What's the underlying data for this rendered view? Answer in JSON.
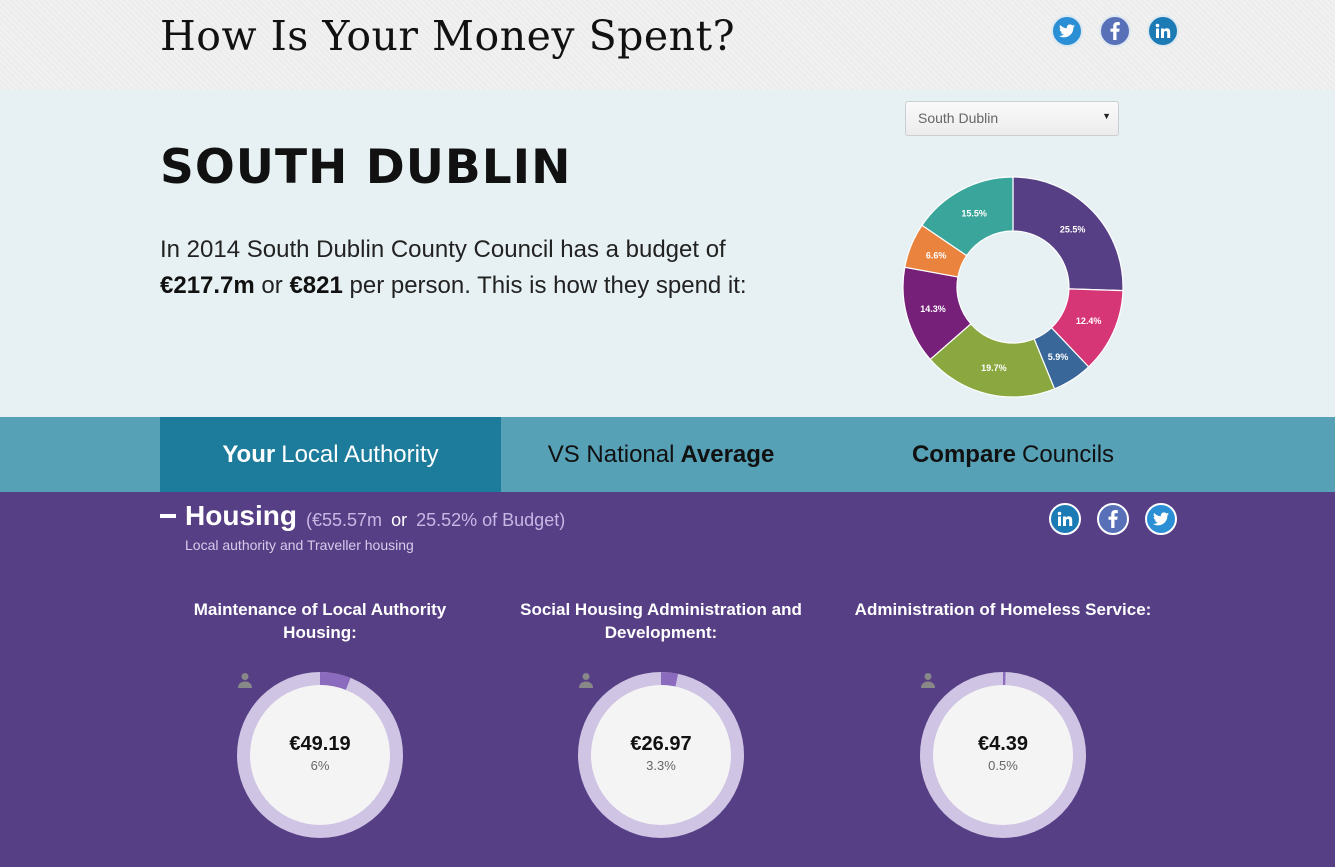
{
  "header": {
    "title": "How Is Your Money Spent?",
    "share_icons": [
      "twitter-icon",
      "facebook-icon",
      "linkedin-icon"
    ]
  },
  "hero": {
    "region_select": {
      "selected": "South Dublin"
    },
    "council_name": "SOUTH DUBLIN",
    "intro_prefix": "In 2014 South Dublin County Council has a budget of",
    "budget_total": "€217.7m",
    "intro_or": "or",
    "budget_per_person": "€821",
    "intro_suffix": "per person. This is how they spend it:"
  },
  "chart_data": {
    "type": "pie",
    "donut": true,
    "categories": [
      "Housing",
      "",
      "",
      "",
      "",
      "",
      ""
    ],
    "values": [
      25.5,
      12.4,
      5.9,
      19.7,
      14.3,
      6.6,
      15.5
    ],
    "labels": [
      "25.5%",
      "12.4%",
      "5.9%",
      "19.7%",
      "14.3%",
      "6.6%",
      "15.5%"
    ],
    "colors": [
      "#573f85",
      "#d63576",
      "#3a679a",
      "#8aa83f",
      "#762079",
      "#e9833e",
      "#3aa59a"
    ]
  },
  "tabs": [
    {
      "bold": "Your",
      "rest": "Local Authority"
    },
    {
      "rest": "VS National",
      "bold": "Average"
    },
    {
      "bold": "Compare",
      "rest": "Councils"
    }
  ],
  "section": {
    "title": "Housing",
    "amount": "(€55.57m",
    "or": "or",
    "share": "25.52% of Budget)",
    "subtitle": "Local authority and Traveller housing",
    "colors": {
      "background": "#573f85",
      "gauge_track": "#cfc4e4",
      "gauge_fill": "#8b6bbd"
    },
    "items": [
      {
        "title": "Maintenance of Local Authority Housing:",
        "value": "€49.19",
        "percent": "6%",
        "fraction": 0.06
      },
      {
        "title": "Social Housing Administration and Development:",
        "value": "€26.97",
        "percent": "3.3%",
        "fraction": 0.033
      },
      {
        "title": "Administration of Homeless Service:",
        "value": "€4.39",
        "percent": "0.5%",
        "fraction": 0.005
      }
    ]
  }
}
